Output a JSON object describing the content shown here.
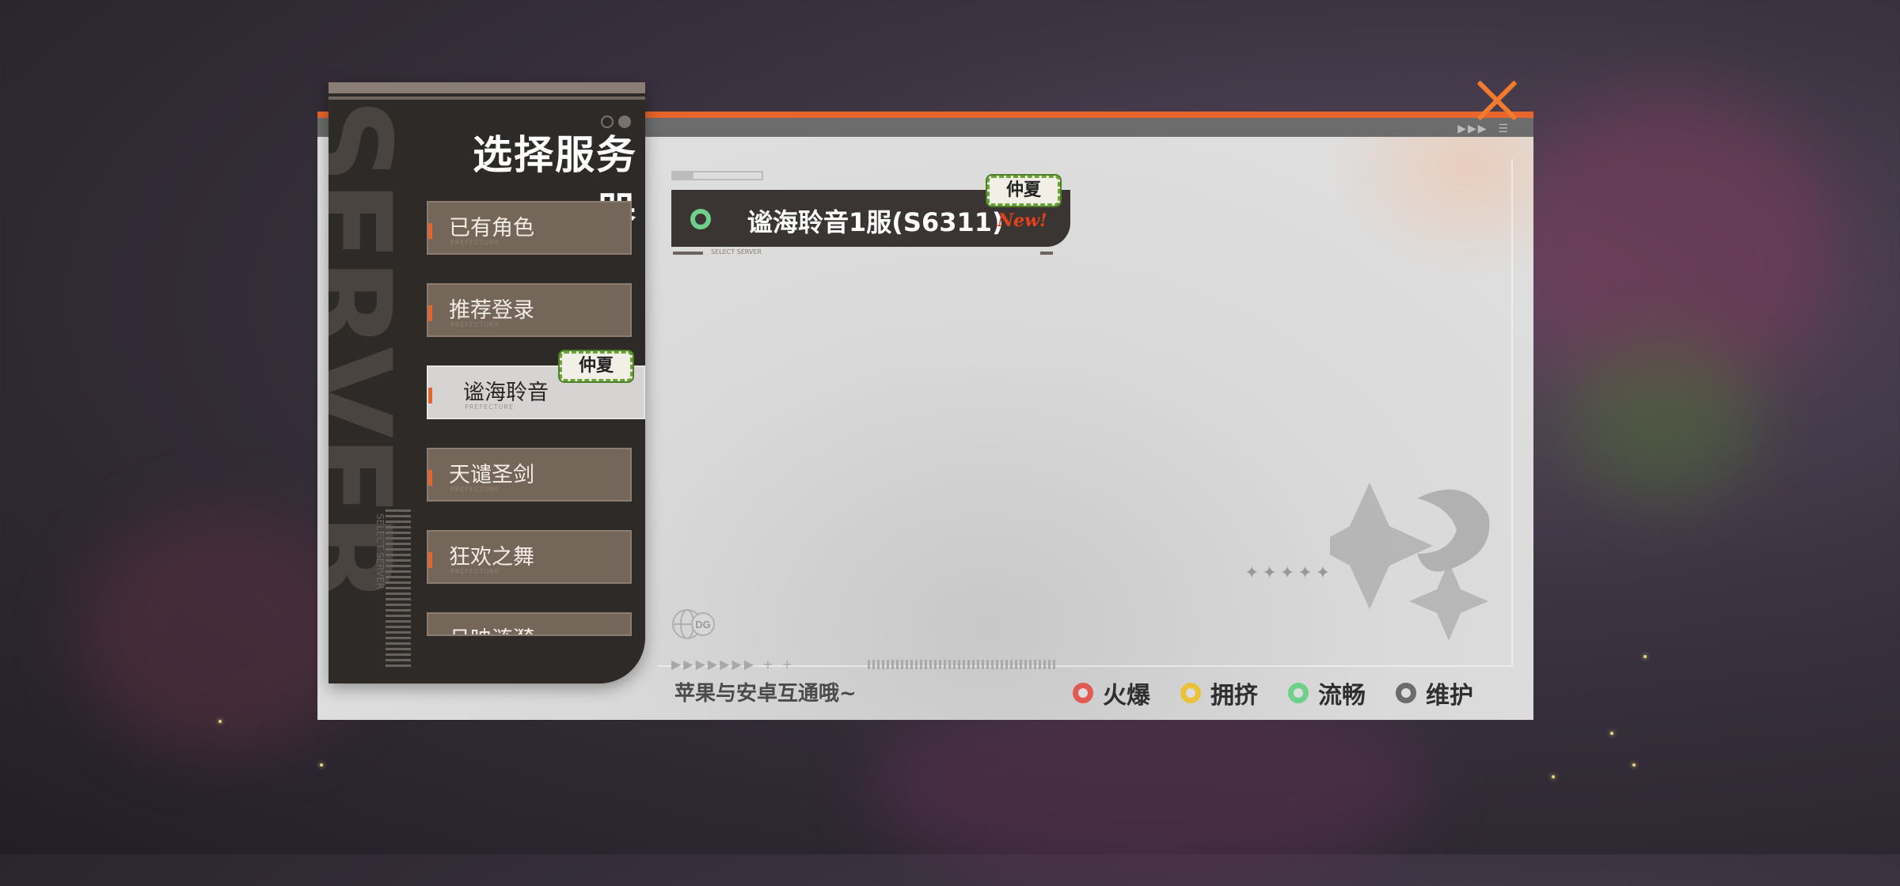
{
  "sidebar": {
    "title": "选择服务器",
    "watermark": "SERVER",
    "vertical_caption": "SELECT SERVER",
    "items": [
      {
        "label": "已有角色",
        "sub": "PREFECTURE",
        "active": false
      },
      {
        "label": "推荐登录",
        "sub": "PREFECTURE",
        "active": false
      },
      {
        "label": "谧海聆音",
        "sub": "PREFECTURE",
        "active": true,
        "tag": "仲夏"
      },
      {
        "label": "天谴圣剑",
        "sub": "PREFECTURE",
        "active": false
      },
      {
        "label": "狂欢之舞",
        "sub": "PREFECTURE",
        "active": false
      },
      {
        "label": "月映涟漪",
        "sub": "",
        "active": false
      }
    ]
  },
  "server_list": [
    {
      "name": "谧海聆音1服(S6311)",
      "tag": "仲夏",
      "badge": "New!",
      "footer": "SELECT SERVER",
      "status": "流畅"
    }
  ],
  "footer": {
    "note": "苹果与安卓互通哦~",
    "globe_label": "DG"
  },
  "legend": [
    {
      "label": "火爆",
      "color": "#e25b52"
    },
    {
      "label": "拥挤",
      "color": "#e8c23a"
    },
    {
      "label": "流畅",
      "color": "#6fd08c"
    },
    {
      "label": "维护",
      "color": "#6b6b6b"
    }
  ],
  "colors": {
    "accent": "#e7642a",
    "panel": "#dcdcdc",
    "sidebar": "#2e2a28"
  },
  "icons": {
    "close": "close-icon",
    "globe": "globe-icon",
    "emblem": "dragon-emblem-icon"
  }
}
